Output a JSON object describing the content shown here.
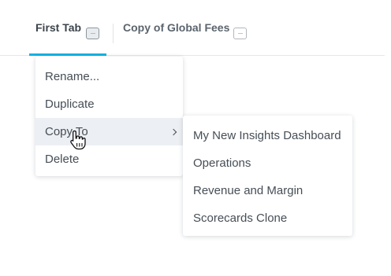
{
  "tabs": [
    {
      "label": "First Tab",
      "menu_label": "···"
    },
    {
      "label": "Copy of Global Fees",
      "menu_label": "···"
    }
  ],
  "context_menu": {
    "items": [
      {
        "label": "Rename..."
      },
      {
        "label": "Duplicate"
      },
      {
        "label": "Copy To"
      },
      {
        "label": "Delete"
      }
    ]
  },
  "copy_to_submenu": {
    "items": [
      {
        "label": "My New Insights Dashboard"
      },
      {
        "label": "Operations"
      },
      {
        "label": "Revenue and Margin"
      },
      {
        "label": "Scorecards Clone"
      }
    ]
  },
  "colors": {
    "accent": "#14b2e2",
    "text": "#464e56",
    "hover_bg": "#eceff3"
  }
}
